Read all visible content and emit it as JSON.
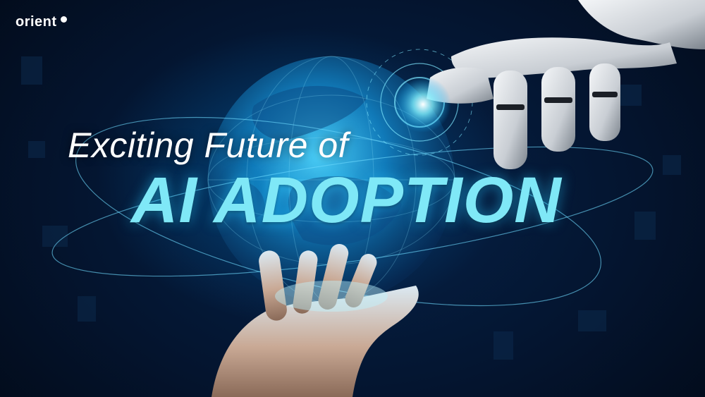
{
  "brand": {
    "name": "orient"
  },
  "headline": {
    "line1": "Exciting Future of",
    "line2": "AI ADOPTION"
  },
  "colors": {
    "background": "#031327",
    "accent": "#7fe8f7",
    "text": "#ffffff",
    "glow": "#3fd0ff"
  },
  "icons": [
    "globe-icon",
    "robot-hand-icon",
    "human-hand-icon"
  ]
}
